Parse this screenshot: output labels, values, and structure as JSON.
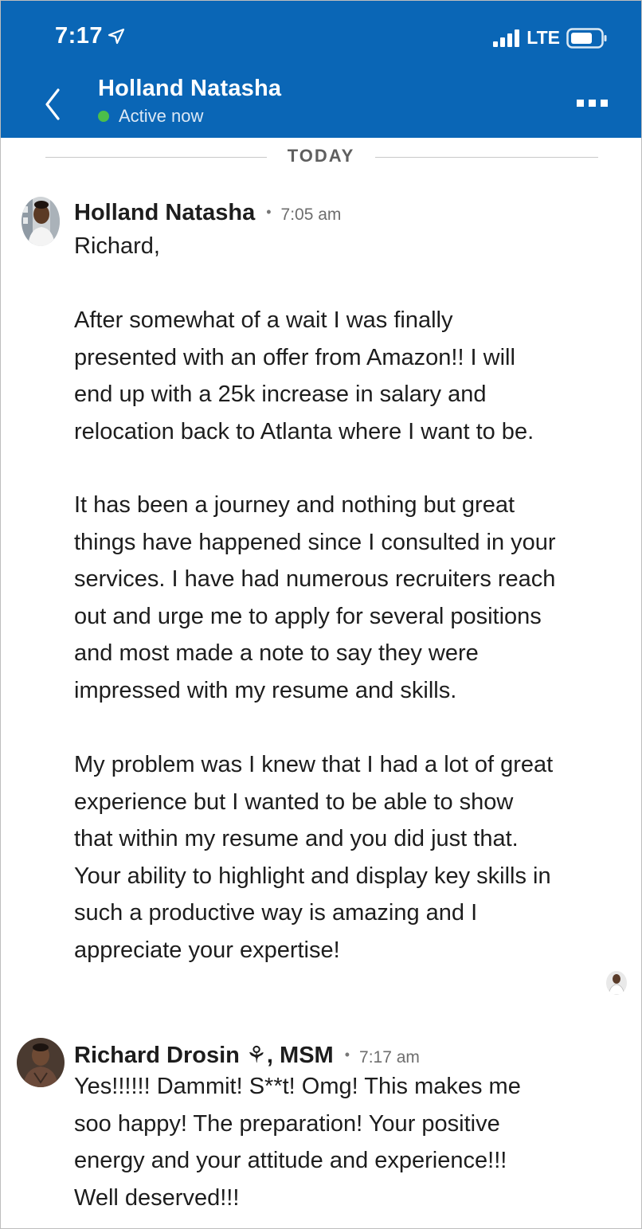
{
  "status_bar": {
    "time": "7:17",
    "network": "LTE",
    "icons": [
      "location-arrow-icon",
      "signal-bars-icon",
      "battery-icon"
    ]
  },
  "header": {
    "back_icon": "chevron-left-icon",
    "contact_name": "Holland Natasha",
    "presence": "Active now",
    "more_icon": "more-dots-icon"
  },
  "conversation": {
    "day_label": "TODAY",
    "messages": [
      {
        "sender": "Holland Natasha",
        "separator": "•",
        "time": "7:05 am",
        "paragraphs": [
          "Richard,",
          "After somewhat of a wait I was finally\npresented with an offer from Amazon!! I will\nend up with a 25k increase in salary and\nrelocation back to Atlanta where I want to be.",
          "It has been a journey and nothing but great\nthings have happened since I consulted in your\nservices. I have had numerous recruiters reach\nout and urge me to apply for several positions\nand most made a note to say they were\nimpressed with my resume and skills.",
          "My problem was I knew that I had a lot of great\nexperience but I wanted to be able to show\nthat within my resume and you did just that.\nYour ability to highlight and display key skills in\nsuch a productive way is amazing and I\nappreciate your expertise!"
        ]
      },
      {
        "sender": "Richard Drosin ⚘, MSM",
        "separator": "•",
        "time": "7:17 am",
        "paragraphs": [
          "Yes!!!!!! Dammit! S**t! Omg! This makes me\nsoo happy! The preparation! Your positive\nenergy and your attitude and experience!!!\nWell deserved!!!"
        ]
      }
    ]
  },
  "colors": {
    "header_bg": "#0a66b6",
    "presence_green": "#4cbf4a",
    "divider": "#c9c9c9",
    "text_primary": "#1d1d1d",
    "text_secondary": "#6e6e6e"
  }
}
